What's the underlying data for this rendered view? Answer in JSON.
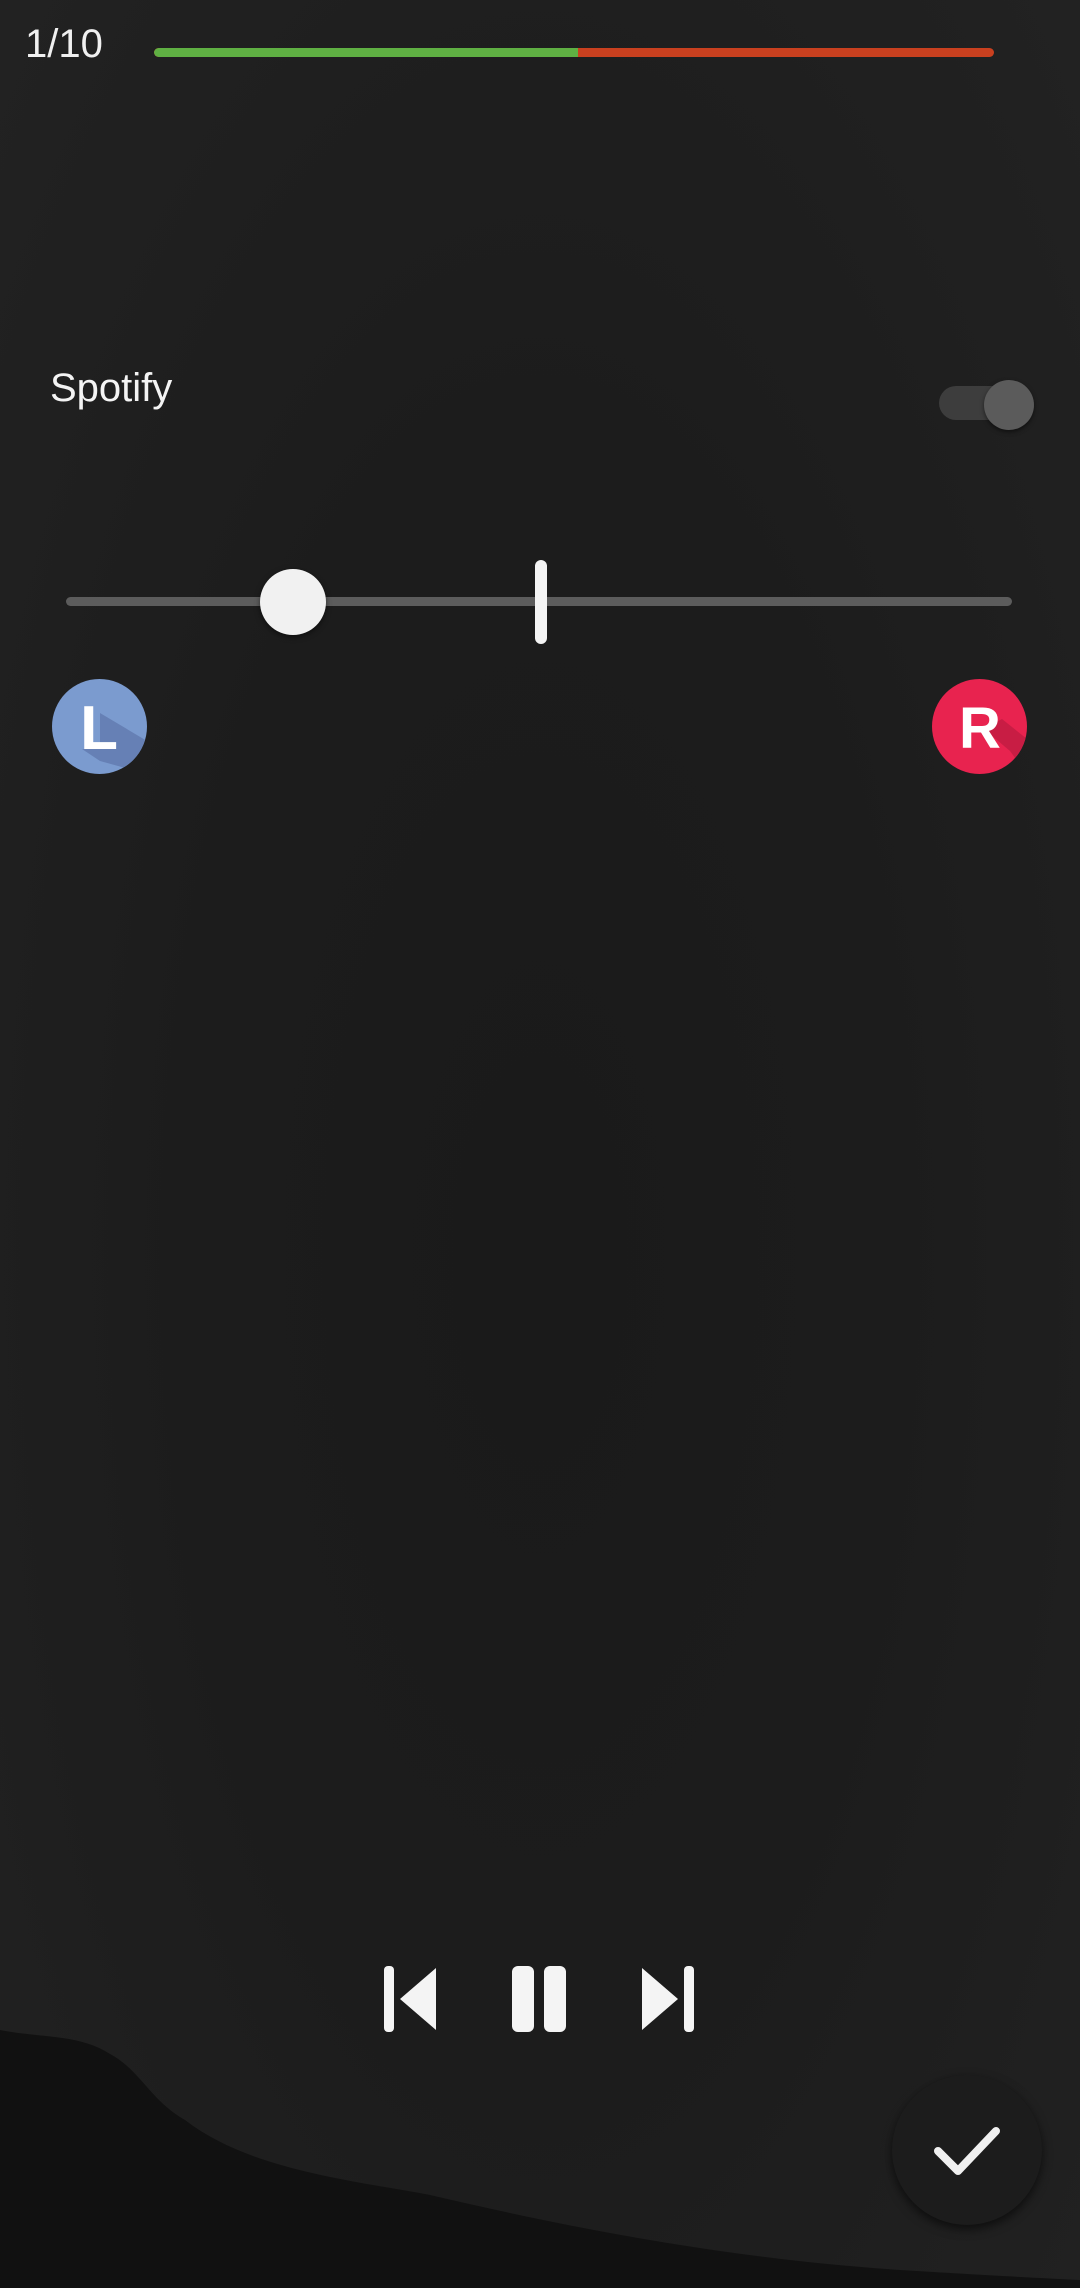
{
  "header": {
    "counter": "1/10",
    "progress": 0.505
  },
  "settings": {
    "app_label": "Spotify",
    "toggle_on": true
  },
  "balance": {
    "value": 0.24,
    "left_label": "L",
    "right_label": "R"
  },
  "player": {
    "controls": [
      "previous-icon",
      "pause-icon",
      "next-icon"
    ]
  },
  "fab": {
    "icon": "check-icon"
  },
  "colors": {
    "progress_done": "#5fb043",
    "progress_remaining": "#c9401f",
    "left_channel": "#7b9bcf",
    "right_channel": "#e8234f",
    "background": "#1c1c1c"
  }
}
